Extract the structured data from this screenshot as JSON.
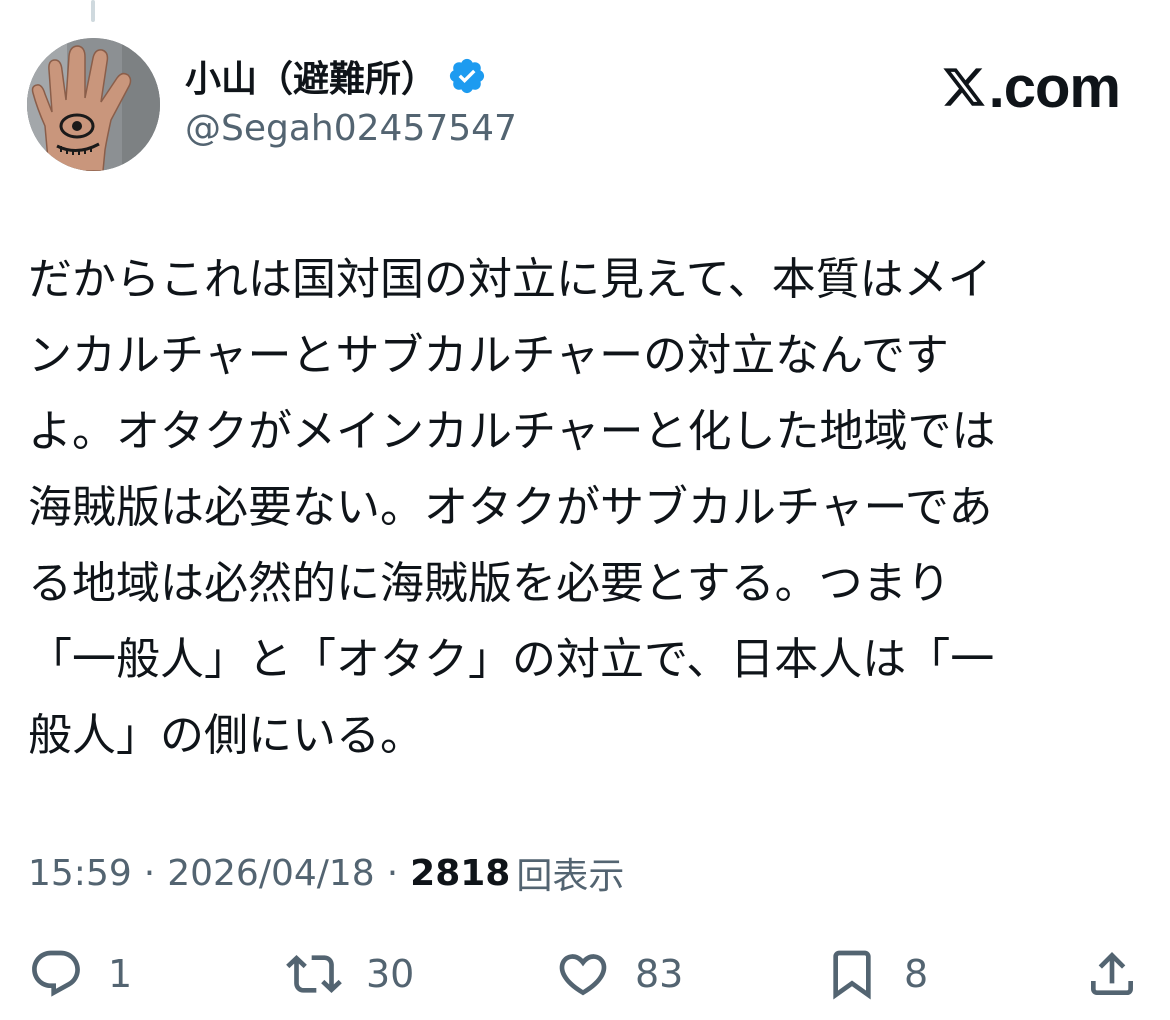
{
  "author": {
    "display_name": "小山（避難所）",
    "handle": "@Segah02457547",
    "verified": true,
    "avatar_icon": "hand-eye-avatar"
  },
  "brand": {
    "logo_icon": "x-logo-icon",
    "domain_text": ".com"
  },
  "tweet": {
    "text": "だからこれは国対国の対立に見えて、本質はメイ\nンカルチャーとサブカルチャーの対立なんです\nよ。オタクがメインカルチャーと化した地域では\n海賊版は必要ない。オタクがサブカルチャーであ\nる地域は必然的に海賊版を必要とする。つまり\n「一般人」と「オタク」の対立で、日本人は「一\n般人」の側にいる。"
  },
  "meta": {
    "time": "15:59",
    "separator": "·",
    "date": "2026/04/18",
    "views_count": "2818",
    "views_label": "回表示"
  },
  "actions": {
    "reply": {
      "icon": "reply-icon",
      "count": "1"
    },
    "retweet": {
      "icon": "retweet-icon",
      "count": "30"
    },
    "like": {
      "icon": "heart-icon",
      "count": "83"
    },
    "bookmark": {
      "icon": "bookmark-icon",
      "count": "8"
    },
    "share": {
      "icon": "share-icon"
    }
  },
  "colors": {
    "text_primary": "#0f1419",
    "text_secondary": "#536471",
    "verified_blue": "#1d9bf0"
  }
}
